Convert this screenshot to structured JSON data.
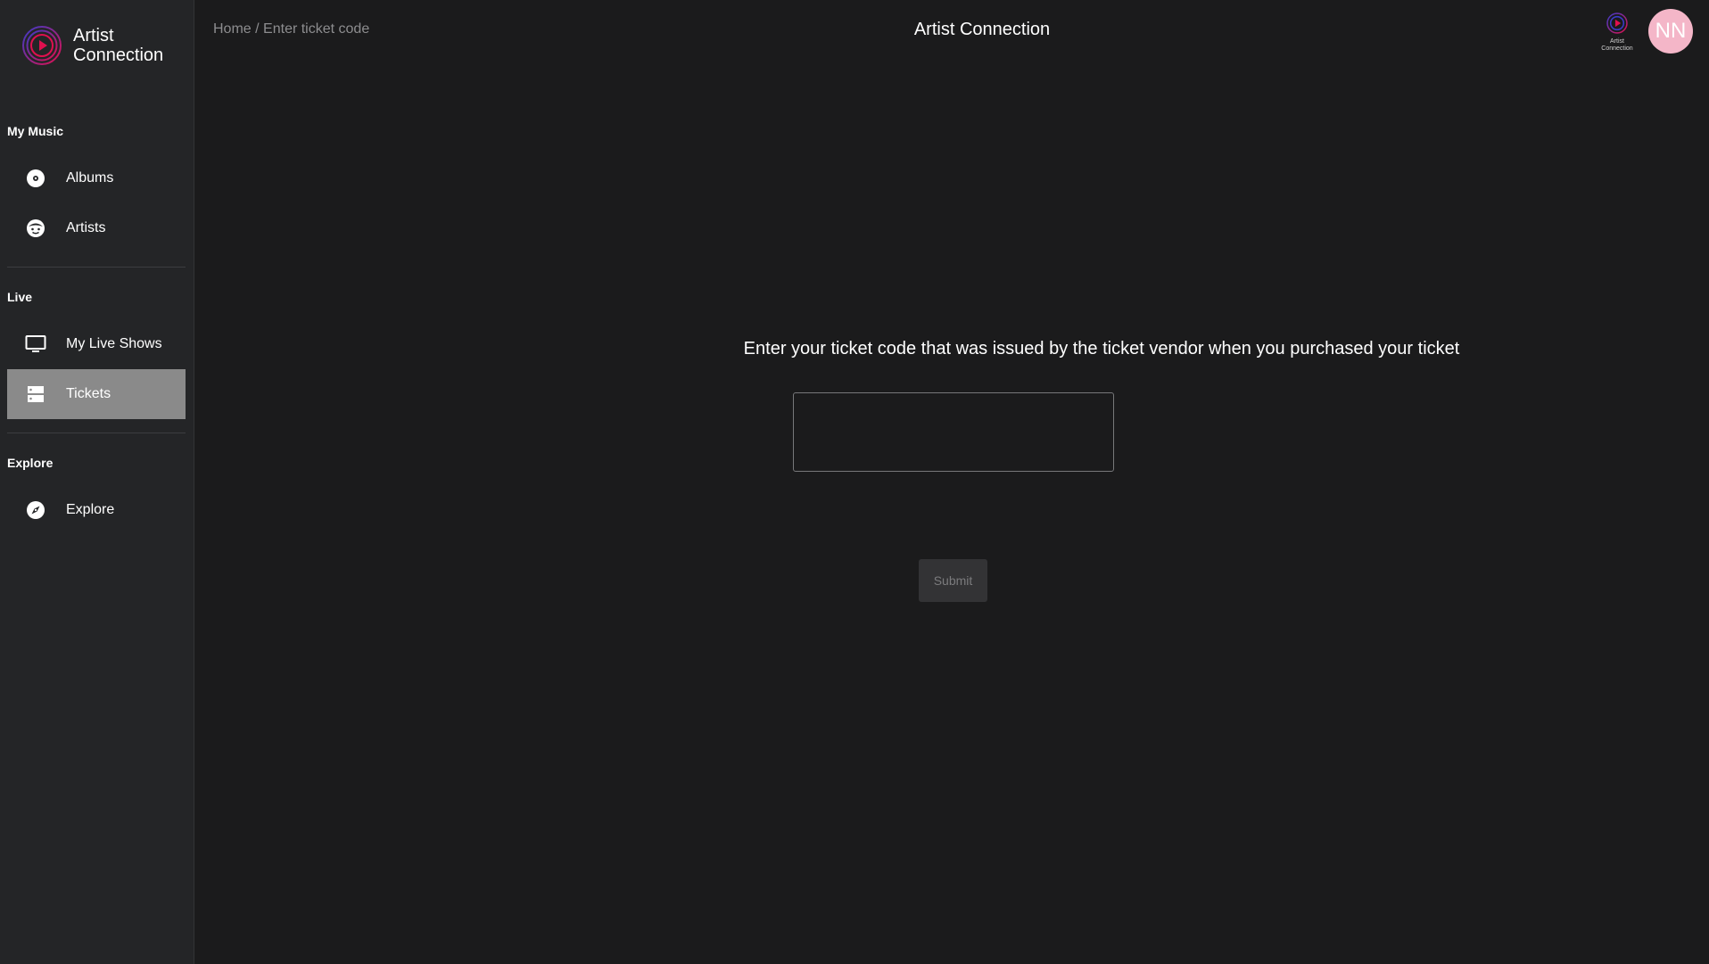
{
  "brand": {
    "line1": "Artist",
    "line2": "Connection",
    "small_line1": "Artist",
    "small_line2": "Connection"
  },
  "sidebar": {
    "sections": [
      {
        "label": "My Music",
        "items": [
          {
            "label": "Albums",
            "icon": "disc-icon"
          },
          {
            "label": "Artists",
            "icon": "face-icon"
          }
        ]
      },
      {
        "label": "Live",
        "items": [
          {
            "label": "My Live Shows",
            "icon": "monitor-icon"
          },
          {
            "label": "Tickets",
            "icon": "ticket-icon",
            "active": true
          }
        ]
      },
      {
        "label": "Explore",
        "items": [
          {
            "label": "Explore",
            "icon": "compass-icon"
          }
        ]
      }
    ]
  },
  "header": {
    "breadcrumb_home": "Home",
    "breadcrumb_sep": "/",
    "breadcrumb_current": "Enter ticket code",
    "title": "Artist Connection",
    "avatar_initials": "NN"
  },
  "main": {
    "prompt": "Enter your ticket code that was issued by the ticket vendor when you purchased your ticket",
    "input_value": "",
    "submit_label": "Submit"
  },
  "colors": {
    "background": "#1b1b1c",
    "sidebar": "#242527",
    "active_item": "#8a8a8a",
    "avatar": "#f4b6c8",
    "logo_red": "#e0104f",
    "logo_blue": "#3b3bc8"
  }
}
